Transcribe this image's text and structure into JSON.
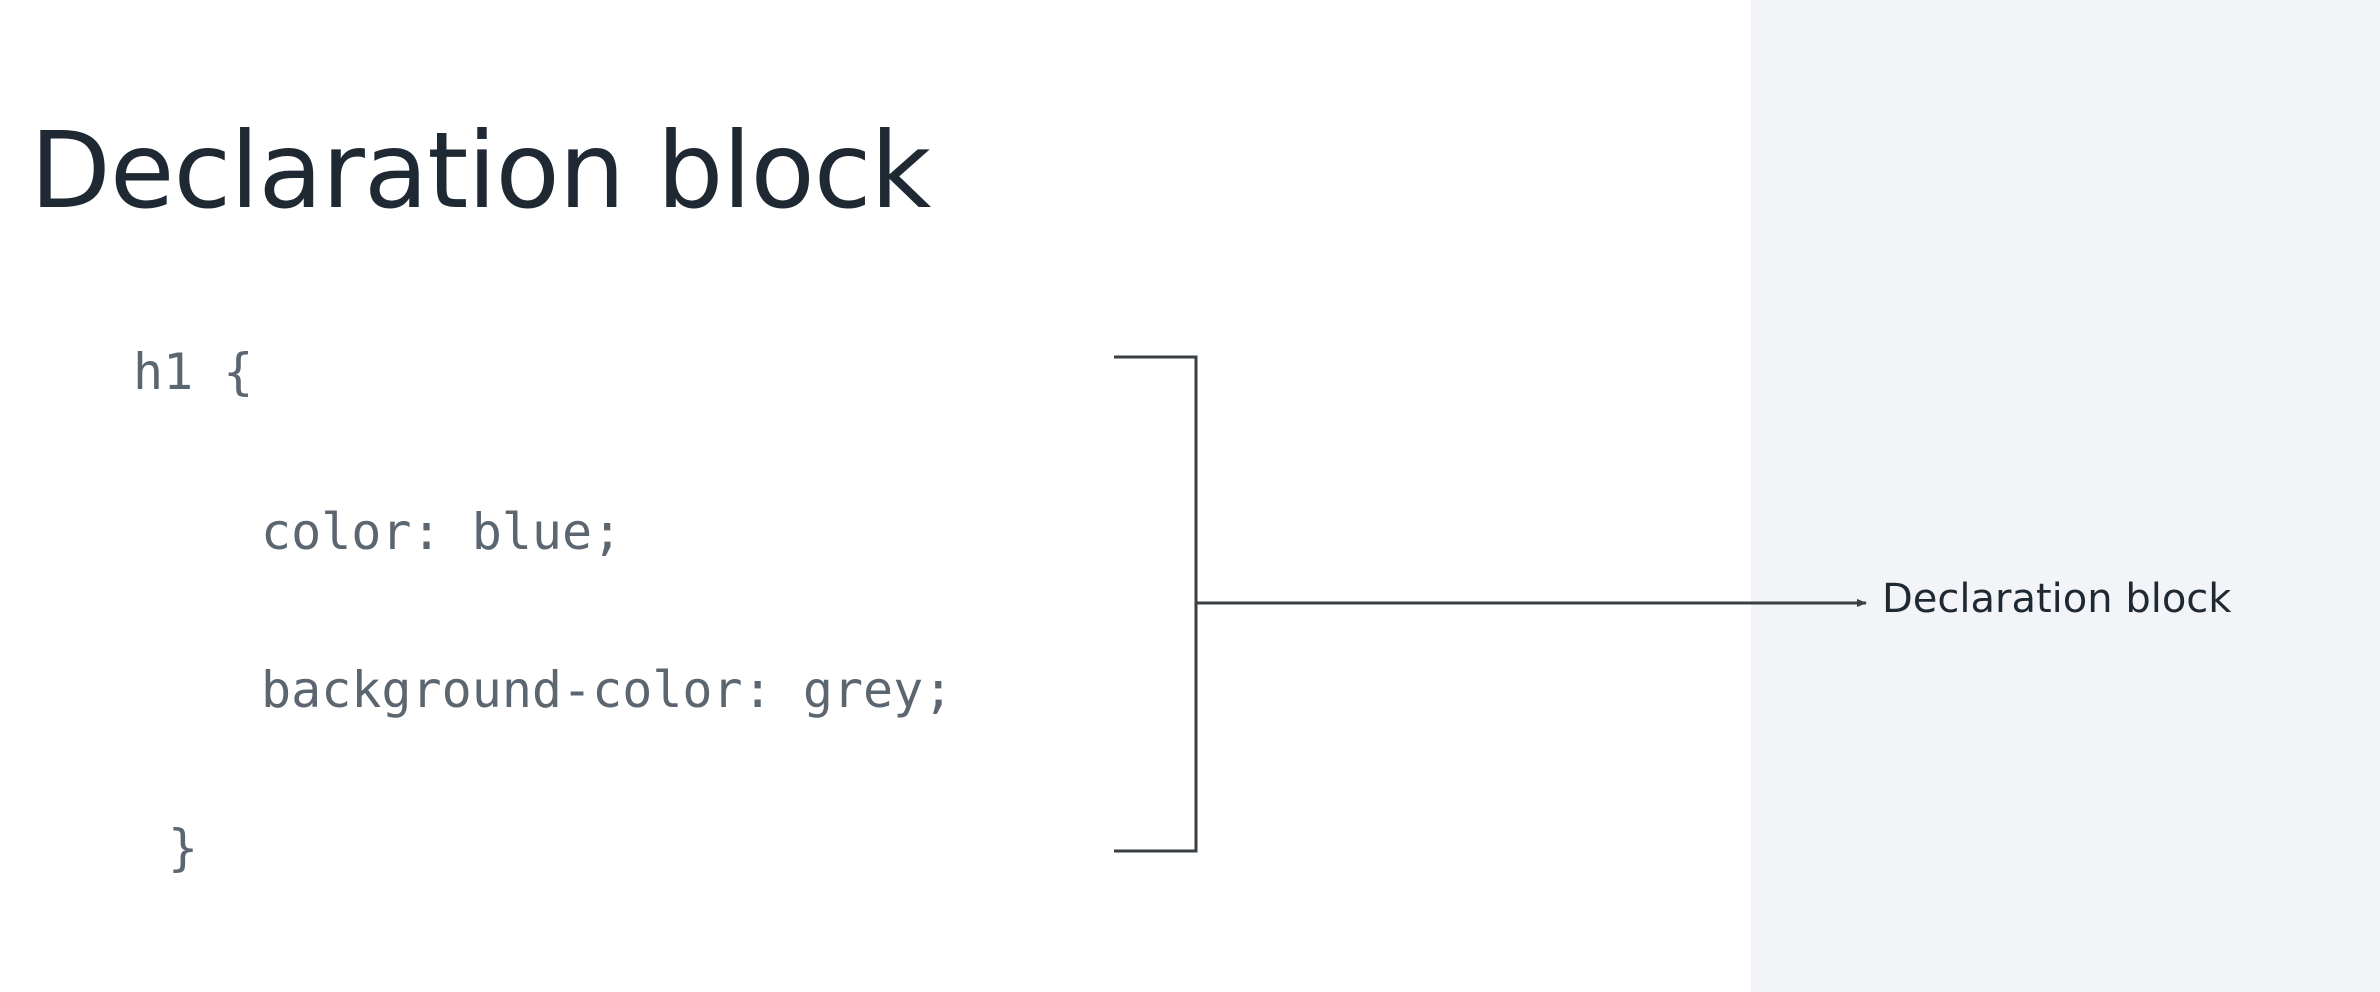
{
  "slide": {
    "title": "Declaration block",
    "code_lines": [
      "h1 {",
      "color: blue;",
      "background-color: grey;",
      "}"
    ],
    "callout_label": "Declaration block"
  },
  "colors": {
    "background": "#ffffff",
    "right_panel": "#f2f4f7",
    "title_text": "#1f2933",
    "code_text": "#5b6670",
    "bracket_stroke": "#3a3f44"
  }
}
